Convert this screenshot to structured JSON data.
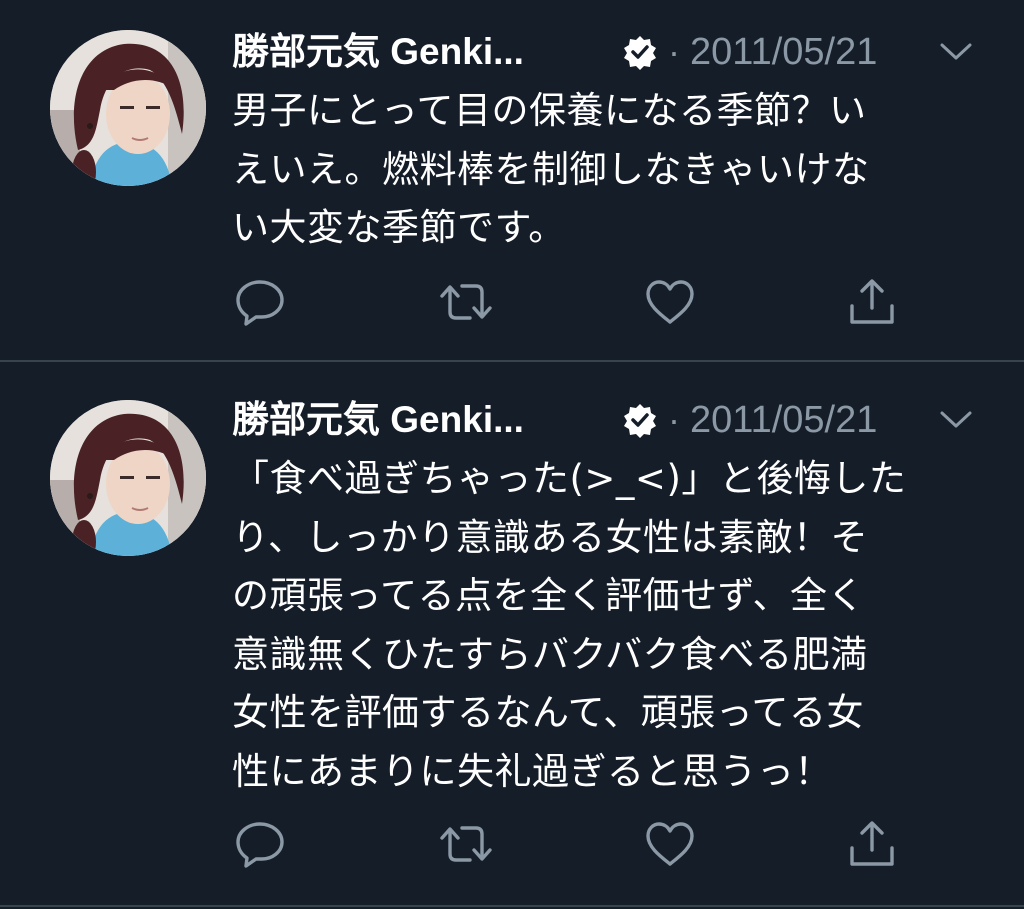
{
  "tweets": [
    {
      "author": {
        "display_name": "勝部元気 Genki...",
        "verified_icon": "verified-badge-icon"
      },
      "separator": "·",
      "date": "2011/05/21",
      "text_lines": [
        "男子にとって目の保養になる季節？い",
        "えいえ。燃料棒を制御しなきゃいけな",
        "い大変な季節です。"
      ],
      "actions": [
        "reply-icon",
        "retweet-icon",
        "like-icon",
        "share-icon"
      ]
    },
    {
      "author": {
        "display_name": "勝部元気 Genki...",
        "verified_icon": "verified-badge-icon"
      },
      "separator": "·",
      "date": "2011/05/21",
      "text_lines": [
        "「食べ過ぎちゃった(>_<)」と後悔した",
        "り、しっかり意識ある女性は素敵！そ",
        "の頑張ってる点を全く評価せず、全く",
        "意識無くひたすらバクバク食べる肥満",
        "女性を評価するなんて、頑張ってる女",
        "性にあまりに失礼過ぎると思うっ！"
      ],
      "actions": [
        "reply-icon",
        "retweet-icon",
        "like-icon",
        "share-icon"
      ]
    }
  ],
  "colors": {
    "background": "#151d28",
    "text": "#ffffff",
    "muted": "#8b98a5",
    "divider": "#38444d"
  }
}
